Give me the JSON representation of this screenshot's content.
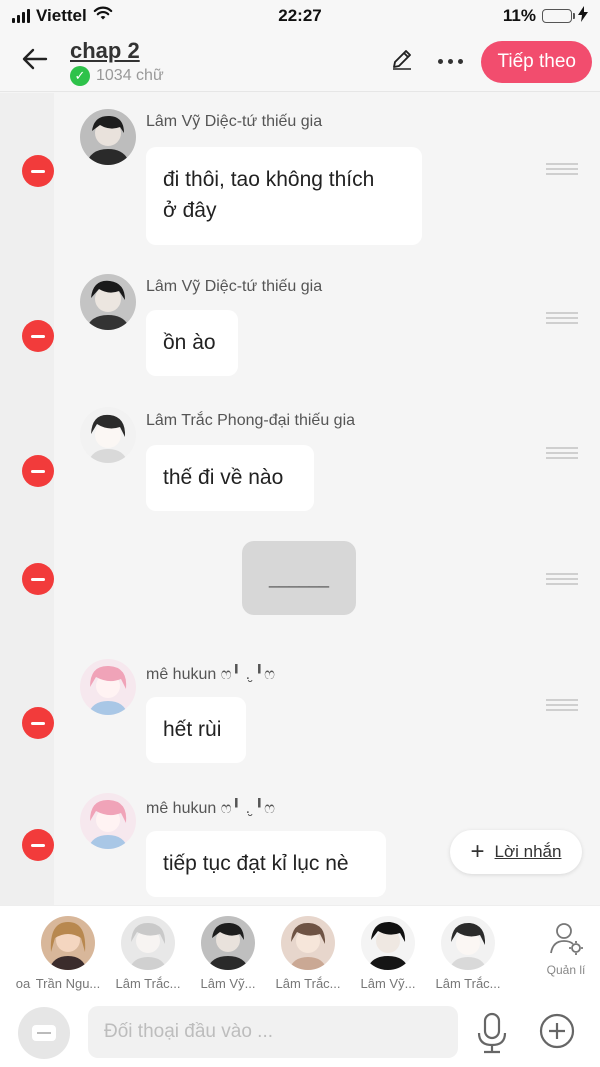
{
  "status_bar": {
    "carrier": "Viettel",
    "time": "22:27",
    "battery": "11%",
    "battery_level": 0.11,
    "icons": [
      "signal-icon",
      "wifi-icon",
      "battery-icon",
      "charging-icon"
    ]
  },
  "header": {
    "title": "chap 2",
    "word_count": "1034 chữ",
    "next_label": "Tiếp theo",
    "accent": "#f24d6e",
    "icons": [
      "back-arrow-icon",
      "check-icon",
      "pencil-icon",
      "more-icon"
    ]
  },
  "messages": [
    {
      "kind": "character",
      "name": "Lâm Vỹ Diệc-tứ thiếu gia",
      "text_lines": [
        "đi thôi, tao không thích",
        "ở đây"
      ]
    },
    {
      "kind": "character",
      "name": "Lâm Vỹ Diệc-tứ thiếu gia",
      "text_lines": [
        "ồn ào"
      ]
    },
    {
      "kind": "character",
      "name": "Lâm Trắc Phong-đại thiếu gia",
      "text_lines": [
        "thế đi về nào"
      ]
    },
    {
      "kind": "narration",
      "text": "______"
    },
    {
      "kind": "character",
      "name": "mê hukun ෆ╹ .̮ ╹ෆ",
      "text_lines": [
        "hết rùi"
      ]
    },
    {
      "kind": "character",
      "name": "mê hukun ෆ╹ .̮ ╹ෆ",
      "text_lines": [
        "tiếp tục đạt kỉ lục nè"
      ]
    }
  ],
  "note_button": {
    "label": "Lời nhắn"
  },
  "characters": [
    {
      "name": "oa"
    },
    {
      "name": "Trần Ngu..."
    },
    {
      "name": "Lâm Trắc..."
    },
    {
      "name": "Lâm Vỹ..."
    },
    {
      "name": "Lâm Trắc..."
    },
    {
      "name": "Lâm Vỹ..."
    },
    {
      "name": "Lâm Trắc..."
    }
  ],
  "manage_label": "Quản lí",
  "input": {
    "placeholder": "Đối thoại đầu vào ...",
    "value": ""
  },
  "colors": {
    "delete": "#f23b3b",
    "check": "#2ec24a",
    "battery_low": "#e53935"
  }
}
